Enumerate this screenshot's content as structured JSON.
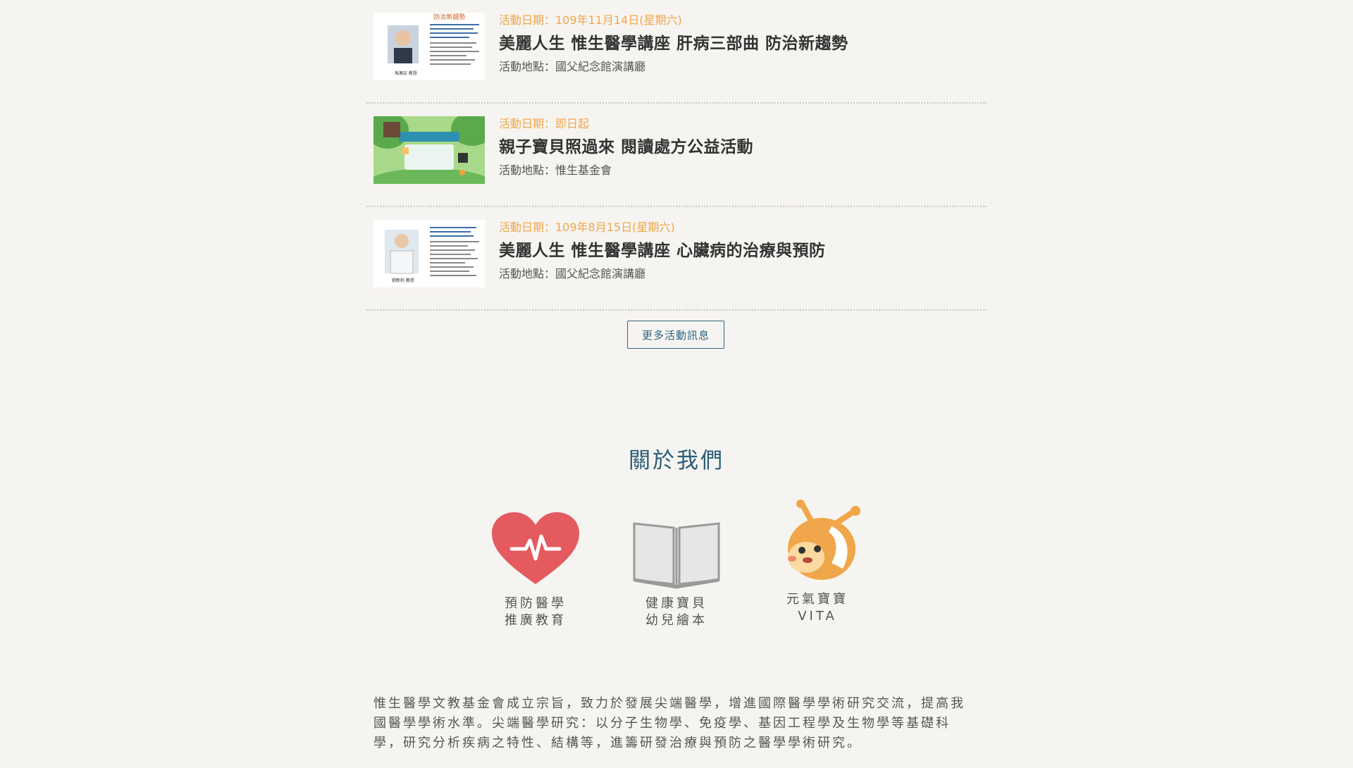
{
  "events": [
    {
      "date": "活動日期：109年11月14日(星期六)",
      "title": "美麗人生 惟生醫學講座 肝病三部曲 防治新趨勢",
      "place": "活動地點：國父紀念館演講廳",
      "thumb_heading": "防治新趨勢",
      "thumb_name": "馬萬宏 教授"
    },
    {
      "date": "活動日期：即日起",
      "title": "親子寶貝照過來 閱讀處方公益活動",
      "place": "活動地點：惟生基金會"
    },
    {
      "date": "活動日期：109年8月15日(星期六)",
      "title": "美麗人生 惟生醫學講座 心臟病的治療與預防",
      "place": "活動地點：國父紀念館演講廳",
      "thumb_name": "劉新和 教授"
    }
  ],
  "more_button": "更多活動訊息",
  "about": {
    "title": "關於我們",
    "features": [
      {
        "icon": "heart-pulse-icon",
        "line1": "預防醫學",
        "line2": "推廣教育"
      },
      {
        "icon": "open-book-icon",
        "line1": "健康寶貝",
        "line2": "幼兒繪本"
      },
      {
        "icon": "vita-mascot-icon",
        "line1": "元氣寶寶",
        "line2": "VITA"
      }
    ],
    "description": "惟生醫學文教基金會成立宗旨，致力於發展尖端醫學，增進國際醫學學術研究交流，提高我國醫學學術水準。尖端醫學研究：以分子生物學、免疫學、基因工程學及生物學等基礎科學，研究分析疾病之特性、結構等，進籌研發治療與預防之醫學學術研究。"
  },
  "colors": {
    "background": "#f6f4f0",
    "date": "#f0a64a",
    "accent": "#2f6480",
    "heart": "#e45a5f"
  }
}
